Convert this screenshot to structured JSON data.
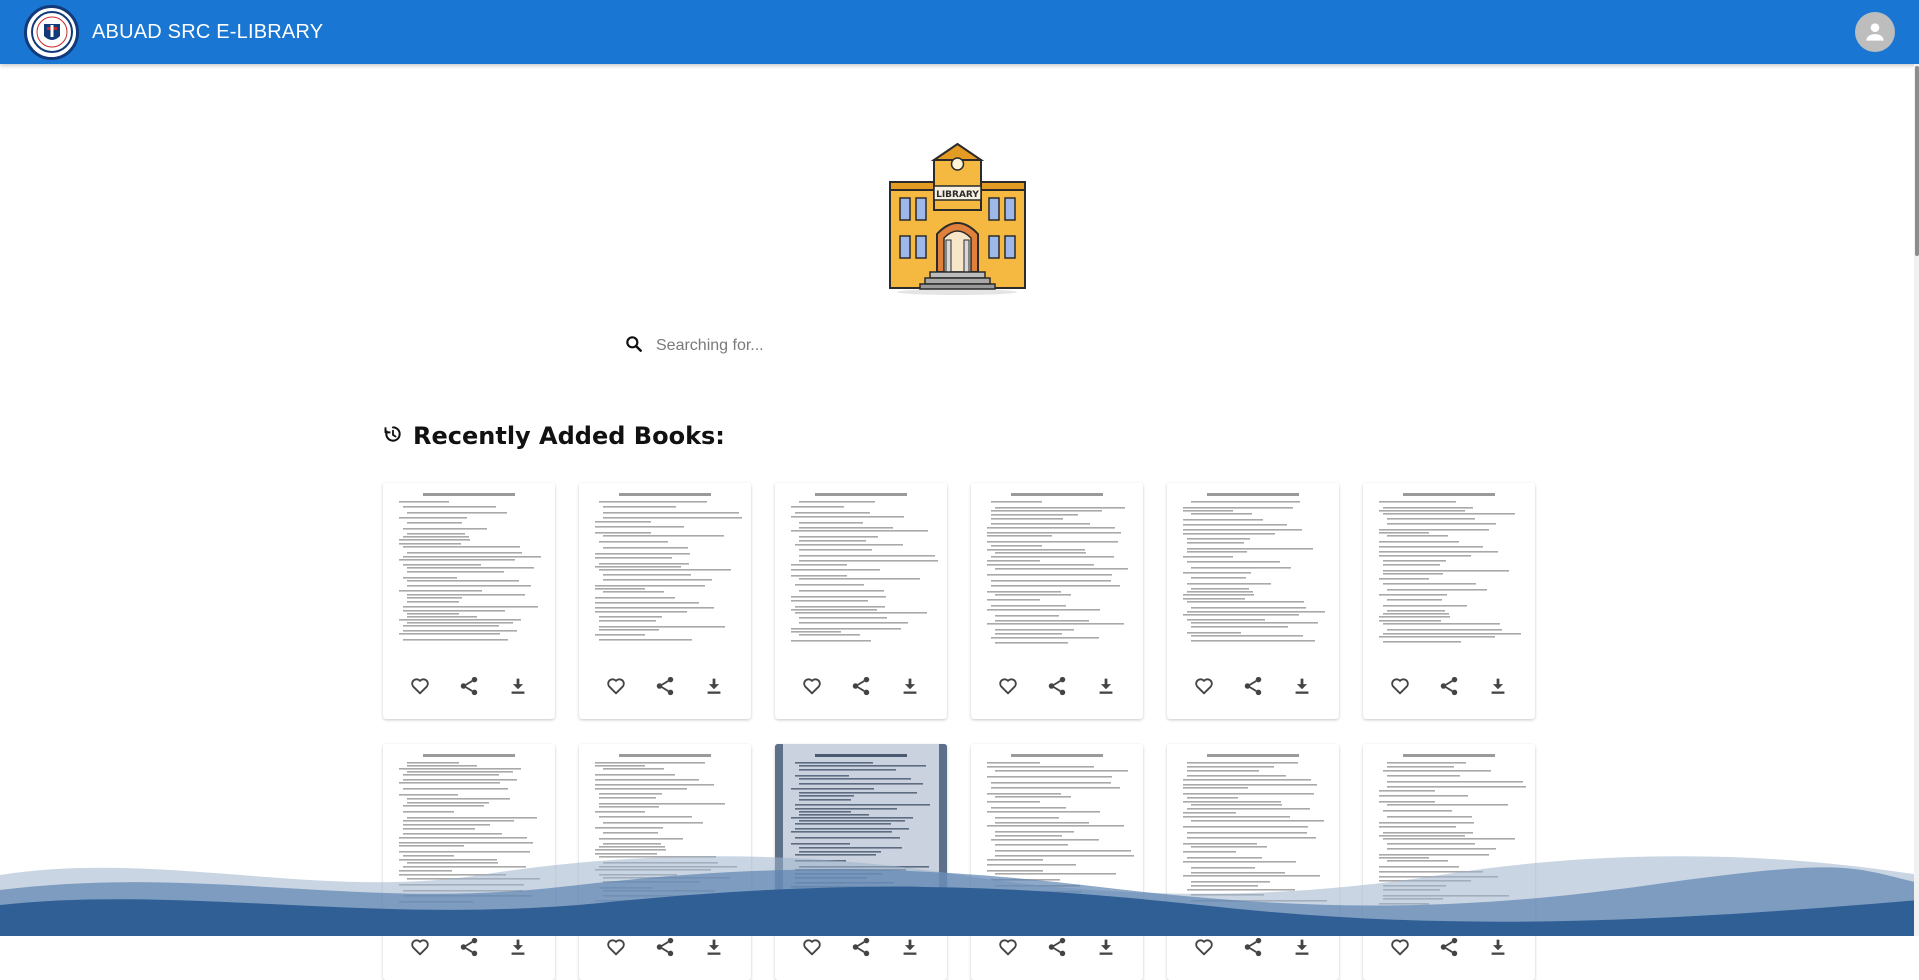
{
  "header": {
    "app_title": "ABUAD SRC E-LIBRARY",
    "logo_icon": "abuad-src-logo",
    "avatar_icon": "account-circle-icon"
  },
  "hero": {
    "image": "library-building-illustration",
    "sign_text": "LIBRARY"
  },
  "search": {
    "placeholder": "Searching for...",
    "value": "",
    "icon": "search-icon"
  },
  "recent": {
    "icon": "history-icon",
    "title": "Recently Added Books:"
  },
  "books": [
    {
      "thumb": "document-page"
    },
    {
      "thumb": "document-page"
    },
    {
      "thumb": "document-page"
    },
    {
      "thumb": "document-page"
    },
    {
      "thumb": "document-page"
    },
    {
      "thumb": "document-page"
    },
    {
      "thumb": "document-page"
    },
    {
      "thumb": "document-page"
    },
    {
      "thumb": "photographed-document"
    },
    {
      "thumb": "document-page"
    },
    {
      "thumb": "document-page"
    },
    {
      "thumb": "document-page"
    }
  ],
  "card_actions": [
    "favorite-icon",
    "share-icon",
    "download-icon"
  ],
  "colors": {
    "appbar": "#1976d2",
    "wave_dark": "#2f5f95",
    "wave_light": "#9db3cc"
  }
}
